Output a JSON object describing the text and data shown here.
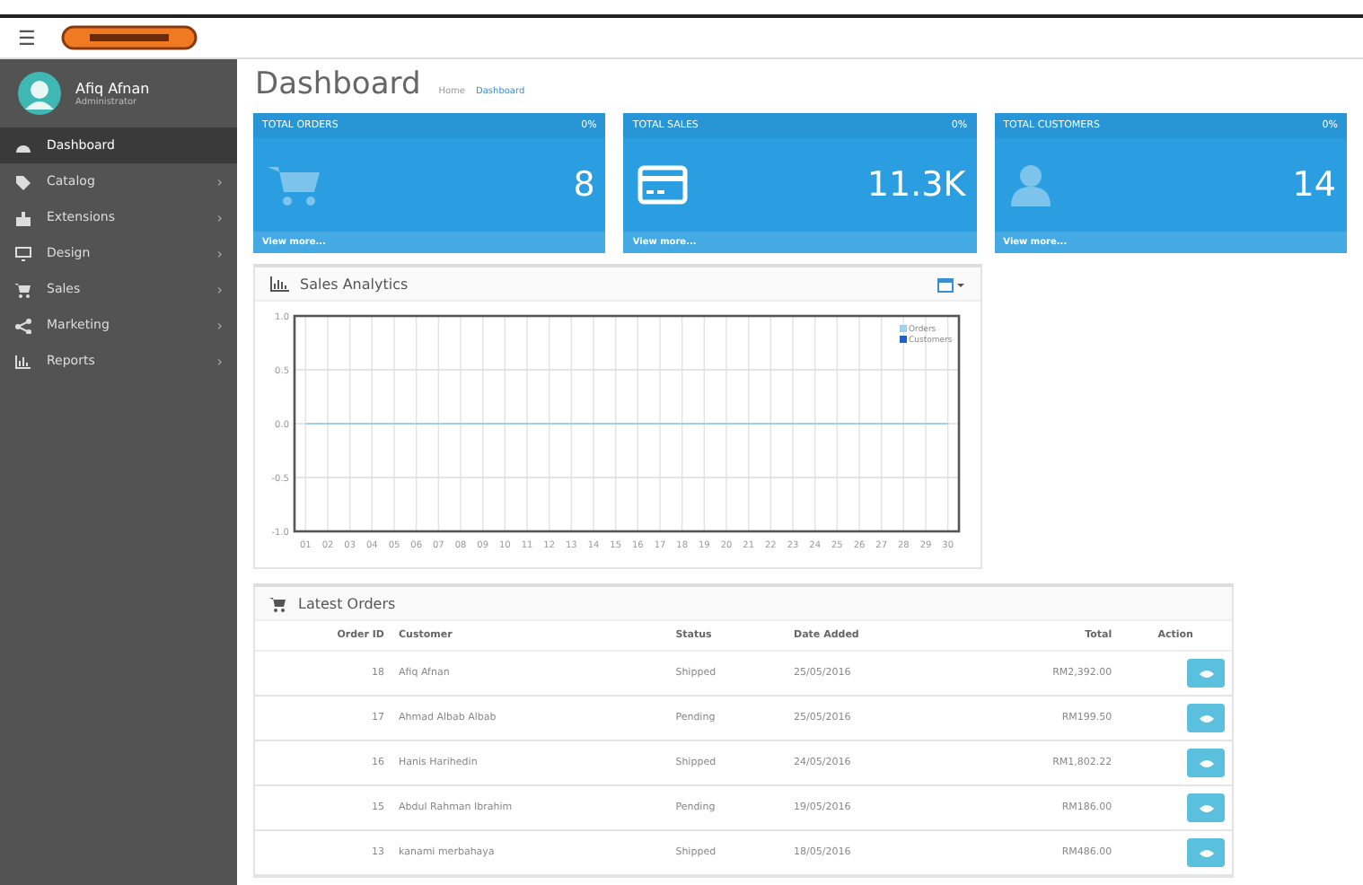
{
  "header": {
    "menu_toggle": "☰"
  },
  "user": {
    "name": "Afiq Afnan",
    "role": "Administrator"
  },
  "sidebar": {
    "items": [
      {
        "label": "Dashboard",
        "selected": true
      },
      {
        "label": "Catalog",
        "selected": false,
        "chevron": "›"
      },
      {
        "label": "Extensions",
        "selected": false,
        "chevron": "›"
      },
      {
        "label": "Design",
        "selected": false,
        "chevron": "›"
      },
      {
        "label": "Sales",
        "selected": false,
        "chevron": "›"
      },
      {
        "label": "Marketing",
        "selected": false,
        "chevron": "›"
      },
      {
        "label": "Reports",
        "selected": false,
        "chevron": "›"
      }
    ]
  },
  "page": {
    "title": "Dashboard",
    "breadcrumb": [
      "Home",
      "Dashboard"
    ]
  },
  "tiles": [
    {
      "title": "TOTAL ORDERS",
      "percent": "0%",
      "value": "8",
      "link": "View more..."
    },
    {
      "title": "TOTAL SALES",
      "percent": "0%",
      "value": "11.3K",
      "link": "View more..."
    },
    {
      "title": "TOTAL CUSTOMERS",
      "percent": "0%",
      "value": "14",
      "link": "View more..."
    }
  ],
  "analytics": {
    "title": "Sales Analytics",
    "chart_data": {
      "type": "line",
      "categories": [
        "01",
        "02",
        "03",
        "04",
        "05",
        "06",
        "07",
        "08",
        "09",
        "10",
        "11",
        "12",
        "13",
        "14",
        "15",
        "16",
        "17",
        "18",
        "19",
        "20",
        "21",
        "22",
        "23",
        "24",
        "25",
        "26",
        "27",
        "28",
        "29",
        "30"
      ],
      "series": [
        {
          "name": "Orders",
          "color": "#9fd0f0",
          "values": [
            0,
            0,
            0,
            0,
            0,
            0,
            0,
            0,
            0,
            0,
            0,
            0,
            0,
            0,
            0,
            0,
            0,
            0,
            0,
            0,
            0,
            0,
            0,
            0,
            0,
            0,
            0,
            0,
            0,
            0
          ]
        },
        {
          "name": "Customers",
          "color": "#1f5fc8",
          "values": [
            null,
            null,
            null,
            null,
            null,
            null,
            null,
            null,
            null,
            null,
            null,
            null,
            null,
            null,
            null,
            null,
            null,
            null,
            null,
            null,
            null,
            null,
            null,
            null,
            null,
            null,
            null,
            null,
            null,
            null
          ]
        }
      ],
      "grid": true,
      "legend": "top-right",
      "ylim": [
        -1,
        1
      ],
      "yticks": [
        {
          "value": 1,
          "label": "1.0"
        },
        {
          "value": 0.5,
          "label": "0.5"
        },
        {
          "value": 0,
          "label": "0.0"
        },
        {
          "value": -0.5,
          "label": "-0.5"
        },
        {
          "value": -1,
          "label": "-1.0"
        }
      ]
    }
  },
  "orders": {
    "title": "Latest Orders",
    "columns": [
      "Order ID",
      "Customer",
      "Status",
      "Date Added",
      "Total",
      "Action"
    ],
    "rows": [
      {
        "id": "18",
        "customer": "Afiq Afnan",
        "status": "Shipped",
        "date": "25/05/2016",
        "total": "RM2,392.00"
      },
      {
        "id": "17",
        "customer": "Ahmad Albab Albab",
        "status": "Pending",
        "date": "25/05/2016",
        "total": "RM199.50"
      },
      {
        "id": "16",
        "customer": "Hanis Harihedin",
        "status": "Shipped",
        "date": "24/05/2016",
        "total": "RM1,802.22"
      },
      {
        "id": "15",
        "customer": "Abdul Rahman Ibrahim",
        "status": "Pending",
        "date": "19/05/2016",
        "total": "RM186.00"
      },
      {
        "id": "13",
        "customer": "kanami merbahaya",
        "status": "Shipped",
        "date": "18/05/2016",
        "total": "RM486.00"
      }
    ]
  }
}
